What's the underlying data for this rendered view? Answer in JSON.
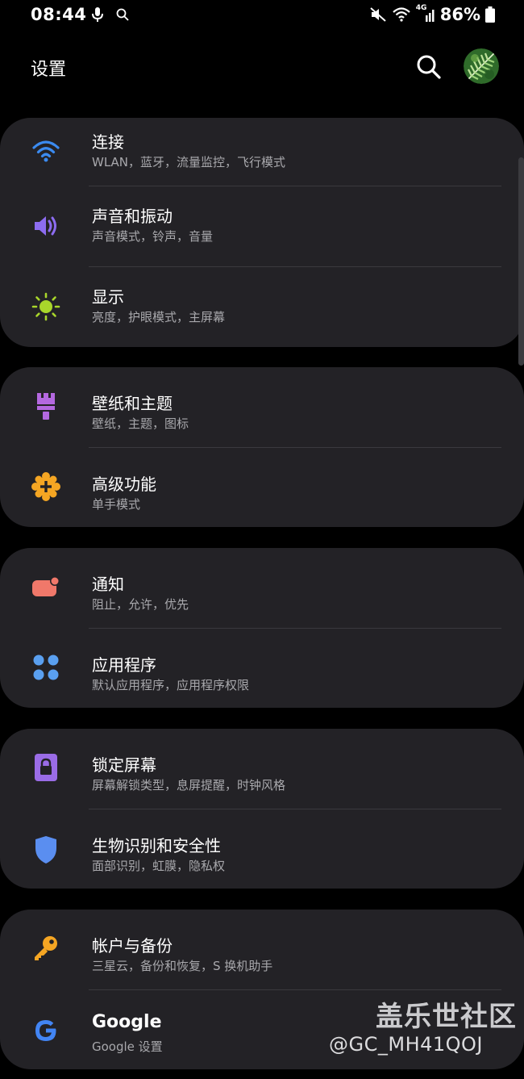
{
  "status_bar": {
    "time": "08:44",
    "battery": "86%",
    "network_label": "4G"
  },
  "header": {
    "title": "设置",
    "search_icon": "search-icon",
    "avatar_desc": "fern-leaf-avatar"
  },
  "groups": [
    {
      "items": [
        {
          "title": "连接",
          "subtitle": "WLAN，蓝牙，流量监控，飞行模式",
          "icon": "wifi-icon",
          "color": "#3b8bf0"
        },
        {
          "title": "声音和振动",
          "subtitle": "声音模式，铃声，音量",
          "icon": "volume-icon",
          "color": "#8c6cf0"
        },
        {
          "title": "显示",
          "subtitle": "亮度，护眼模式，主屏幕",
          "icon": "brightness-icon",
          "color": "#a9d62b"
        }
      ]
    },
    {
      "items": [
        {
          "title": "壁纸和主题",
          "subtitle": "壁纸，主题，图标",
          "icon": "paintbrush-icon",
          "color": "#b468e0"
        },
        {
          "title": "高级功能",
          "subtitle": "单手模式",
          "icon": "gear-plus-icon",
          "color": "#f5a623"
        }
      ]
    },
    {
      "items": [
        {
          "title": "通知",
          "subtitle": "阻止，允许，优先",
          "icon": "notification-icon",
          "color": "#f0786a"
        },
        {
          "title": "应用程序",
          "subtitle": "默认应用程序，应用程序权限",
          "icon": "apps-icon",
          "color": "#5aa0f0"
        }
      ]
    },
    {
      "items": [
        {
          "title": "锁定屏幕",
          "subtitle": "屏幕解锁类型，息屏提醒，时钟风格",
          "icon": "lock-icon",
          "color": "#9a6ce6"
        },
        {
          "title": "生物识别和安全性",
          "subtitle": "面部识别，虹膜，隐私权",
          "icon": "shield-icon",
          "color": "#5a8ef0"
        }
      ]
    },
    {
      "items": [
        {
          "title": "帐户与备份",
          "subtitle": "三星云，备份和恢复，S 换机助手",
          "icon": "key-icon",
          "color": "#f5a623"
        },
        {
          "title": "Google",
          "subtitle": "Google 设置",
          "icon": "google-icon",
          "color": "#4285f4"
        }
      ]
    }
  ],
  "watermark": {
    "title": "盖乐世社区",
    "handle": "@GC_MH41QOJ"
  }
}
